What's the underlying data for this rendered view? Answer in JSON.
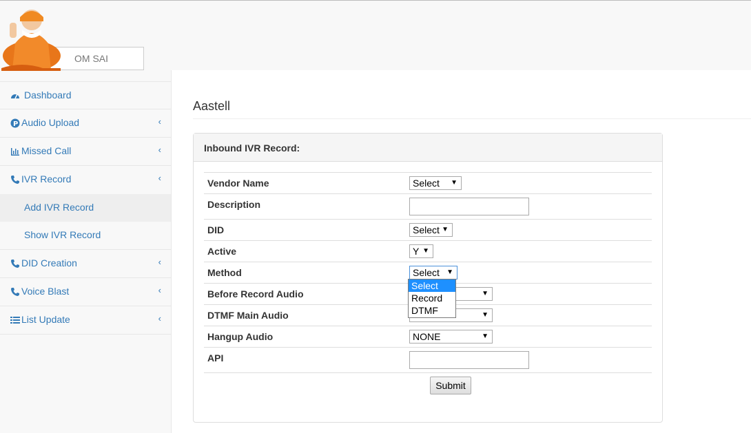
{
  "brand": {
    "name": "OM SAI"
  },
  "sidebar": {
    "items": [
      {
        "label": "Dashboard",
        "icon": "dashboard-icon"
      },
      {
        "label": "Audio Upload",
        "icon": "p-circle-icon",
        "chevron": "‹"
      },
      {
        "label": "Missed Call",
        "icon": "bar-chart-icon",
        "chevron": "‹"
      },
      {
        "label": "IVR Record",
        "icon": "phone-icon",
        "chevron": "‹"
      },
      {
        "label": "DID Creation",
        "icon": "phone-icon",
        "chevron": "‹"
      },
      {
        "label": "Voice Blast",
        "icon": "phone-icon",
        "chevron": "‹"
      },
      {
        "label": "List Update",
        "icon": "list-icon",
        "chevron": "‹"
      }
    ],
    "sub_items": [
      {
        "label": "Add IVR Record",
        "active": true
      },
      {
        "label": "Show IVR Record",
        "active": false
      }
    ]
  },
  "page": {
    "title": "Aastell"
  },
  "panel": {
    "heading": "Inbound IVR Record:"
  },
  "form": {
    "vendor_name": {
      "label": "Vendor Name",
      "value": "Select"
    },
    "description": {
      "label": "Description",
      "value": ""
    },
    "did": {
      "label": "DID",
      "value": "Select"
    },
    "active": {
      "label": "Active",
      "value": "Y"
    },
    "method": {
      "label": "Method",
      "value": "Select",
      "options": [
        "Select",
        "Record",
        "DTMF"
      ],
      "highlighted": "Select"
    },
    "before_record_audio": {
      "label": "Before Record Audio",
      "value": ""
    },
    "dtmf_main_audio": {
      "label": "DTMF Main Audio",
      "value": ""
    },
    "hangup_audio": {
      "label": "Hangup Audio",
      "value": "NONE"
    },
    "api": {
      "label": "API",
      "value": ""
    },
    "submit_label": "Submit"
  },
  "colors": {
    "link": "#337ab7",
    "highlight": "#1e90ff"
  }
}
